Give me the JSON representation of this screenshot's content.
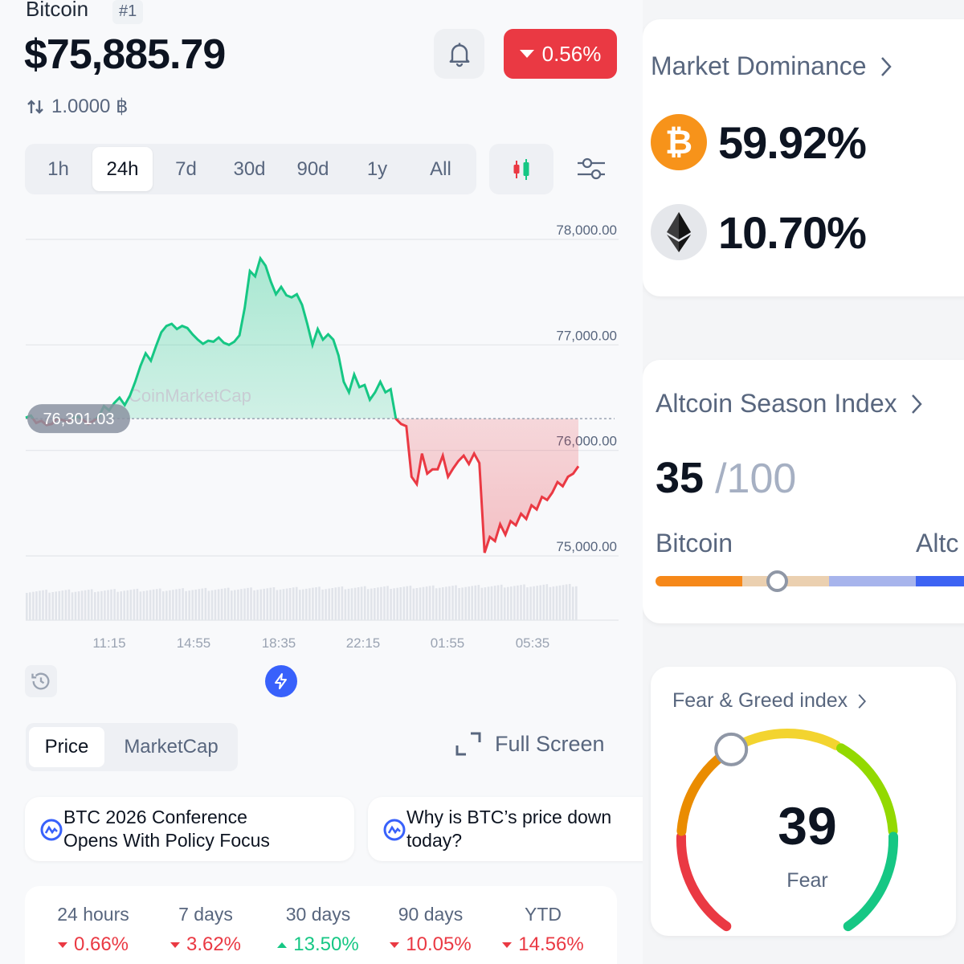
{
  "coin": {
    "name": "Bitcoin",
    "rank": "#1",
    "price": "$75,885.79",
    "conversion": "1.0000 ฿",
    "change_24h": "0.56%"
  },
  "timeframes": [
    "1h",
    "24h",
    "7d",
    "30d",
    "90d",
    "1y",
    "All"
  ],
  "active_timeframe": "24h",
  "chart_data": {
    "type": "area",
    "y_ticks": [
      "78,000.00",
      "77,000.00",
      "76,000.00",
      "75,000.00"
    ],
    "x_ticks": [
      "11:15",
      "14:55",
      "18:35",
      "22:15",
      "01:55",
      "05:35"
    ],
    "ylim": [
      75000,
      78000
    ],
    "baseline_label": "76,301.03",
    "baseline": 76301.03,
    "watermark": "CoinMarketCap",
    "series": [
      {
        "values": [
          76310,
          76330,
          76260,
          76280,
          76240,
          76250,
          76300,
          76290,
          76270,
          76310,
          76320,
          76290,
          76250,
          76280,
          76320,
          76420,
          76380,
          76450,
          76500,
          76430,
          76520,
          76650,
          76800,
          76920,
          76850,
          76990,
          77120,
          77180,
          77200,
          77150,
          77180,
          77160,
          77100,
          77050,
          77010,
          77040,
          77030,
          77070,
          77020,
          77000,
          77030,
          77090,
          77350,
          77700,
          77650,
          77820,
          77750,
          77600,
          77480,
          77550,
          77470,
          77450,
          77480,
          77380,
          77200,
          77000,
          77150,
          77050,
          77100,
          77050,
          76900,
          76650,
          76550,
          76720,
          76600,
          76620,
          76480,
          76550,
          76650,
          76550,
          76580,
          76300,
          76250,
          76230,
          75750,
          75680,
          75970,
          75780,
          75820,
          75820,
          75950,
          75750,
          75830,
          75900,
          75950,
          75870,
          75970,
          75880,
          75030,
          75180,
          75140,
          75300,
          75200,
          75330,
          75290,
          75400,
          75350,
          75480,
          75440,
          75560,
          75530,
          75600,
          75700,
          75660,
          75750,
          75780,
          75850
        ]
      }
    ]
  },
  "chart_controls": {
    "price_tab": "Price",
    "marketcap_tab": "MarketCap",
    "fullscreen": "Full Screen"
  },
  "news": [
    {
      "line1": "BTC 2026 Conference",
      "line2": "Opens With Policy Focus"
    },
    {
      "line1": "Why is BTC’s price down",
      "line2": "today?"
    }
  ],
  "performance": [
    {
      "label": "24 hours",
      "value": "0.66%",
      "dir": "down"
    },
    {
      "label": "7 days",
      "value": "3.62%",
      "dir": "down"
    },
    {
      "label": "30 days",
      "value": "13.50%",
      "dir": "up"
    },
    {
      "label": "90 days",
      "value": "10.05%",
      "dir": "down"
    },
    {
      "label": "YTD",
      "value": "14.56%",
      "dir": "down"
    }
  ],
  "market_dominance": {
    "title": "Market Dominance",
    "btc": "59.92%",
    "eth": "10.70%"
  },
  "altcoin_season": {
    "title": "Altcoin Season Index",
    "value": "35",
    "max": "/100",
    "left_label": "Bitcoin",
    "right_label": "Altc",
    "level": 0.35
  },
  "fear_greed": {
    "title": "Fear & Greed index",
    "value": "39",
    "label": "Fear",
    "level": 0.39
  },
  "colors": {
    "up": "#16c784",
    "down": "#ea3943",
    "accent": "#3861fb"
  }
}
